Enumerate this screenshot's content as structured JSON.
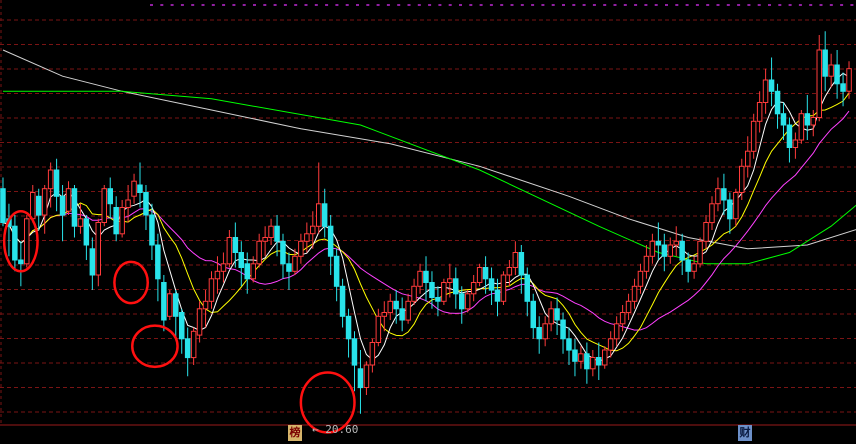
{
  "chart_data": {
    "type": "candlestick",
    "title": "",
    "low_marker_label": "← 20.60",
    "badges": {
      "bang": "榜",
      "cai": "财"
    },
    "ylim": [
      20.3,
      31.5
    ],
    "colors": {
      "background": "#000000",
      "up": "#ff3b3b",
      "down": "#29e3ea",
      "grid": "#7a1414",
      "ma5": "#ffffff",
      "ma10": "#ffff00",
      "ma20": "#ff40ff",
      "ma60": "#00ff00",
      "ma120": "#d2d2d2",
      "circle": "#ff1010"
    },
    "candles": [
      [
        26.6,
        26.9,
        25.7,
        25.6
      ],
      [
        25.8,
        26.2,
        25.6,
        24.8
      ],
      [
        25.6,
        25.9,
        24.7,
        24.4
      ],
      [
        24.7,
        25.2,
        24.6,
        24.0
      ],
      [
        24.6,
        25.9,
        25.8,
        24.5
      ],
      [
        25.8,
        26.7,
        26.5,
        25.7
      ],
      [
        26.4,
        26.6,
        25.9,
        25.5
      ],
      [
        25.9,
        26.7,
        26.6,
        25.4
      ],
      [
        26.6,
        27.3,
        27.1,
        26.1
      ],
      [
        27.1,
        27.4,
        26.4,
        26.0
      ],
      [
        26.4,
        26.7,
        25.9,
        25.2
      ],
      [
        26.0,
        26.8,
        26.6,
        25.9
      ],
      [
        26.6,
        26.7,
        25.6,
        25.3
      ],
      [
        25.6,
        26.2,
        25.8,
        25.4
      ],
      [
        25.8,
        25.9,
        25.1,
        24.7
      ],
      [
        25.0,
        25.3,
        24.3,
        23.9
      ],
      [
        24.3,
        25.8,
        25.7,
        24.0
      ],
      [
        25.7,
        26.7,
        26.6,
        25.6
      ],
      [
        26.6,
        26.9,
        26.2,
        25.8
      ],
      [
        26.1,
        26.4,
        25.4,
        25.2
      ],
      [
        25.4,
        26.3,
        26.1,
        25.3
      ],
      [
        26.1,
        26.7,
        26.3,
        25.7
      ],
      [
        26.4,
        27.0,
        26.8,
        26.2
      ],
      [
        26.7,
        27.3,
        26.5,
        26.1
      ],
      [
        26.5,
        26.7,
        25.9,
        25.5
      ],
      [
        25.9,
        26.2,
        25.1,
        24.7
      ],
      [
        25.1,
        25.4,
        24.2,
        23.6
      ],
      [
        24.1,
        24.3,
        23.1,
        22.8
      ],
      [
        23.2,
        23.9,
        23.8,
        23.1
      ],
      [
        23.8,
        23.9,
        23.2,
        22.6
      ],
      [
        23.3,
        23.4,
        22.6,
        22.2
      ],
      [
        22.6,
        22.9,
        22.1,
        21.6
      ],
      [
        22.1,
        22.9,
        22.8,
        21.9
      ],
      [
        22.7,
        23.6,
        23.4,
        22.5
      ],
      [
        23.4,
        23.9,
        23.6,
        22.9
      ],
      [
        23.6,
        24.4,
        24.2,
        23.4
      ],
      [
        24.2,
        24.8,
        24.4,
        23.8
      ],
      [
        24.4,
        24.9,
        24.6,
        24.1
      ],
      [
        24.6,
        25.5,
        25.3,
        24.5
      ],
      [
        25.3,
        25.7,
        24.9,
        24.5
      ],
      [
        24.9,
        25.2,
        24.5,
        24.0
      ],
      [
        24.6,
        24.9,
        24.2,
        23.8
      ],
      [
        24.2,
        24.8,
        24.6,
        24.1
      ],
      [
        24.6,
        25.4,
        25.2,
        24.5
      ],
      [
        25.2,
        25.6,
        25.3,
        24.8
      ],
      [
        25.3,
        25.8,
        25.6,
        25.1
      ],
      [
        25.6,
        25.9,
        25.2,
        24.8
      ],
      [
        25.2,
        25.4,
        24.6,
        24.2
      ],
      [
        24.6,
        24.9,
        24.4,
        23.9
      ],
      [
        24.4,
        25.0,
        24.8,
        24.3
      ],
      [
        24.8,
        25.4,
        25.2,
        24.6
      ],
      [
        25.2,
        25.7,
        25.4,
        24.9
      ],
      [
        25.4,
        26.0,
        25.6,
        25.0
      ],
      [
        25.6,
        27.3,
        26.2,
        25.4
      ],
      [
        26.2,
        26.6,
        25.6,
        25.3
      ],
      [
        25.6,
        25.9,
        24.8,
        24.3
      ],
      [
        24.8,
        25.0,
        24.0,
        23.6
      ],
      [
        24.0,
        24.2,
        23.2,
        22.9
      ],
      [
        23.2,
        23.4,
        22.6,
        22.1
      ],
      [
        22.6,
        22.8,
        21.9,
        21.2
      ],
      [
        21.8,
        22.3,
        21.3,
        20.6
      ],
      [
        21.3,
        22.0,
        21.9,
        21.1
      ],
      [
        21.9,
        22.6,
        22.5,
        21.7
      ],
      [
        22.5,
        23.4,
        23.2,
        22.4
      ],
      [
        23.2,
        23.6,
        23.3,
        22.8
      ],
      [
        23.3,
        23.8,
        23.6,
        23.1
      ],
      [
        23.6,
        23.9,
        23.4,
        23.0
      ],
      [
        23.4,
        23.7,
        23.1,
        22.8
      ],
      [
        23.1,
        23.8,
        23.6,
        23.0
      ],
      [
        23.6,
        24.2,
        24.0,
        23.5
      ],
      [
        24.0,
        24.6,
        24.4,
        23.8
      ],
      [
        24.4,
        24.8,
        24.1,
        23.6
      ],
      [
        24.1,
        24.4,
        23.7,
        23.4
      ],
      [
        23.7,
        24.0,
        23.6,
        23.2
      ],
      [
        23.6,
        24.2,
        24.1,
        23.5
      ],
      [
        24.1,
        24.6,
        24.2,
        23.7
      ],
      [
        24.2,
        24.5,
        23.8,
        23.4
      ],
      [
        23.8,
        24.0,
        23.4,
        23.0
      ],
      [
        23.4,
        23.9,
        23.8,
        23.3
      ],
      [
        23.8,
        24.3,
        24.1,
        23.6
      ],
      [
        24.1,
        24.6,
        24.5,
        24.0
      ],
      [
        24.5,
        24.8,
        24.2,
        23.8
      ],
      [
        24.2,
        24.5,
        23.9,
        23.5
      ],
      [
        23.9,
        24.2,
        23.6,
        23.2
      ],
      [
        23.6,
        24.4,
        24.3,
        23.5
      ],
      [
        24.3,
        24.7,
        24.5,
        24.0
      ],
      [
        24.5,
        25.2,
        24.9,
        24.3
      ],
      [
        24.9,
        25.1,
        24.3,
        23.8
      ],
      [
        24.3,
        24.5,
        23.6,
        23.2
      ],
      [
        23.6,
        23.8,
        22.9,
        22.6
      ],
      [
        22.9,
        23.2,
        22.6,
        22.2
      ],
      [
        22.6,
        23.2,
        23.0,
        22.4
      ],
      [
        23.0,
        23.6,
        23.4,
        22.8
      ],
      [
        23.4,
        23.7,
        23.1,
        22.7
      ],
      [
        23.1,
        23.3,
        22.6,
        22.2
      ],
      [
        22.6,
        22.9,
        22.3,
        21.9
      ],
      [
        22.3,
        22.6,
        22.0,
        21.6
      ],
      [
        22.0,
        22.4,
        22.2,
        21.8
      ],
      [
        22.2,
        22.5,
        21.8,
        21.4
      ],
      [
        21.8,
        22.3,
        22.1,
        21.6
      ],
      [
        22.1,
        22.5,
        21.9,
        21.5
      ],
      [
        21.9,
        22.4,
        22.3,
        21.8
      ],
      [
        22.3,
        22.8,
        22.6,
        22.1
      ],
      [
        22.6,
        23.2,
        23.0,
        22.4
      ],
      [
        23.0,
        23.5,
        23.3,
        22.8
      ],
      [
        23.3,
        23.8,
        23.6,
        23.1
      ],
      [
        23.6,
        24.2,
        24.0,
        23.4
      ],
      [
        24.0,
        24.6,
        24.4,
        23.8
      ],
      [
        24.4,
        25.1,
        24.8,
        24.2
      ],
      [
        24.8,
        25.4,
        25.2,
        24.6
      ],
      [
        25.2,
        25.7,
        25.1,
        24.7
      ],
      [
        25.1,
        25.4,
        24.8,
        24.4
      ],
      [
        24.8,
        25.3,
        25.1,
        24.6
      ],
      [
        25.1,
        25.6,
        25.2,
        24.8
      ],
      [
        25.2,
        25.4,
        24.7,
        24.3
      ],
      [
        24.7,
        24.9,
        24.4,
        24.1
      ],
      [
        24.4,
        24.8,
        24.6,
        24.2
      ],
      [
        24.6,
        25.3,
        25.2,
        24.5
      ],
      [
        25.2,
        25.9,
        25.7,
        25.0
      ],
      [
        25.7,
        26.4,
        26.2,
        25.5
      ],
      [
        26.2,
        26.9,
        26.6,
        26.0
      ],
      [
        26.6,
        27.0,
        26.3,
        25.9
      ],
      [
        26.3,
        26.5,
        25.8,
        25.4
      ],
      [
        25.8,
        26.6,
        26.5,
        25.6
      ],
      [
        26.5,
        27.4,
        27.2,
        26.3
      ],
      [
        27.2,
        28.0,
        27.6,
        26.9
      ],
      [
        27.6,
        28.6,
        28.4,
        27.4
      ],
      [
        28.4,
        29.2,
        28.9,
        28.1
      ],
      [
        28.9,
        29.8,
        29.5,
        28.6
      ],
      [
        29.5,
        30.1,
        29.2,
        28.8
      ],
      [
        29.2,
        29.4,
        28.6,
        28.2
      ],
      [
        28.6,
        28.9,
        28.3,
        27.9
      ],
      [
        28.3,
        28.5,
        27.7,
        27.3
      ],
      [
        27.7,
        28.1,
        27.9,
        27.4
      ],
      [
        27.9,
        28.7,
        28.6,
        27.8
      ],
      [
        28.6,
        29.1,
        28.3,
        27.9
      ],
      [
        28.3,
        28.7,
        28.5,
        28.0
      ],
      [
        28.5,
        30.7,
        30.3,
        28.4
      ],
      [
        30.3,
        30.8,
        29.6,
        29.2
      ],
      [
        29.6,
        30.2,
        29.9,
        29.3
      ],
      [
        29.9,
        30.3,
        29.4,
        29.0
      ],
      [
        29.4,
        29.7,
        29.2,
        28.8
      ],
      [
        29.2,
        30.0,
        29.8,
        29.0
      ]
    ],
    "ma60": [
      [
        0,
        29.2
      ],
      [
        20,
        29.2
      ],
      [
        35,
        29.0
      ],
      [
        60,
        28.3
      ],
      [
        80,
        27.1
      ],
      [
        100,
        25.6
      ],
      [
        110,
        24.9
      ],
      [
        118,
        24.6
      ],
      [
        125,
        24.6
      ],
      [
        132,
        24.9
      ],
      [
        139,
        25.6
      ],
      [
        145,
        26.4
      ]
    ],
    "ma120": [
      [
        0,
        30.3
      ],
      [
        10,
        29.6
      ],
      [
        20,
        29.2
      ],
      [
        35,
        28.7
      ],
      [
        50,
        28.2
      ],
      [
        65,
        27.8
      ],
      [
        80,
        27.2
      ],
      [
        95,
        26.4
      ],
      [
        105,
        25.8
      ],
      [
        115,
        25.3
      ],
      [
        125,
        25.0
      ],
      [
        135,
        25.1
      ],
      [
        145,
        25.6
      ]
    ],
    "annotations": [
      {
        "type": "circle",
        "x": 3,
        "y": 25.2,
        "rx_bars": 2.8,
        "ry": 0.8
      },
      {
        "type": "circle",
        "x": 21.5,
        "y": 24.1,
        "rx_bars": 2.8,
        "ry": 0.55
      },
      {
        "type": "circle",
        "x": 25.5,
        "y": 22.4,
        "rx_bars": 3.8,
        "ry": 0.55
      },
      {
        "type": "circle",
        "x": 54.5,
        "y": 20.9,
        "rx_bars": 4.5,
        "ry": 0.8
      }
    ]
  }
}
